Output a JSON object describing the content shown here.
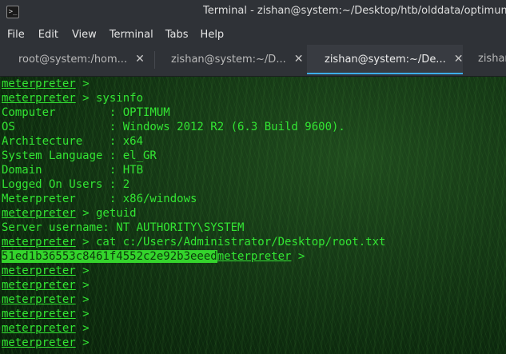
{
  "window": {
    "title": "Terminal - zishan@system:~/Desktop/htb/olddata/optimum",
    "app_icon": "terminal-icon"
  },
  "menubar": {
    "items": [
      "File",
      "Edit",
      "View",
      "Terminal",
      "Tabs",
      "Help"
    ]
  },
  "tabs": [
    {
      "label": "root@system:/hom...",
      "close": "✕",
      "active": false
    },
    {
      "label": "zishan@system:~/D...",
      "close": "✕",
      "active": false
    },
    {
      "label": "zishan@system:~/De...",
      "close": "✕",
      "active": true
    },
    {
      "label": "zishan",
      "close": "",
      "active": false
    }
  ],
  "terminal": {
    "prompt": "meterpreter",
    "prompt_suffix": " >",
    "lines": [
      {
        "prompt": "meterpreter",
        "text": " >"
      },
      {
        "prompt": "meterpreter",
        "text": " > sysinfo"
      },
      {
        "text": "Computer        : OPTIMUM"
      },
      {
        "text": "OS              : Windows 2012 R2 (6.3 Build 9600)."
      },
      {
        "text": "Architecture    : x64"
      },
      {
        "text": "System Language : el_GR"
      },
      {
        "text": "Domain          : HTB"
      },
      {
        "text": "Logged On Users : 2"
      },
      {
        "text": "Meterpreter     : x86/windows"
      },
      {
        "prompt": "meterpreter",
        "text": " > getuid"
      },
      {
        "text": "Server username: NT AUTHORITY\\SYSTEM"
      },
      {
        "prompt": "meterpreter",
        "text": " > cat c:/Users/Administrator/Desktop/root.txt"
      },
      {
        "highlight": "51ed1b36553c8461f4552c2e92b3eeed",
        "prompt": "meterpreter",
        "text": " >"
      },
      {
        "prompt": "meterpreter",
        "text": " >"
      },
      {
        "prompt": "meterpreter",
        "text": " >"
      },
      {
        "prompt": "meterpreter",
        "text": " >"
      },
      {
        "prompt": "meterpreter",
        "text": " >"
      },
      {
        "prompt": "meterpreter",
        "text": " >"
      },
      {
        "prompt": "meterpreter",
        "text": " >"
      }
    ]
  },
  "colors": {
    "terminal_text": "#33e533",
    "highlight_bg": "#34d42c",
    "active_tab_indicator": "#3daee9"
  }
}
